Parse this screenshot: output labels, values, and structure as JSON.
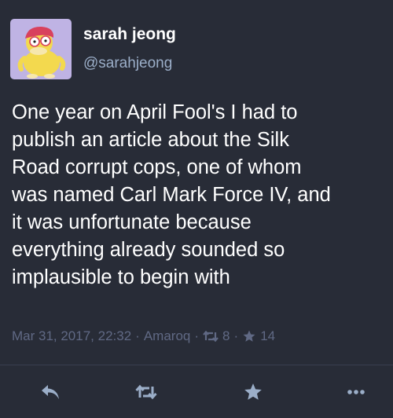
{
  "user": {
    "display_name": "sarah jeong",
    "handle": "@sarahjeong"
  },
  "status": {
    "lines": [
      "One year on April Fool's I had to",
      "publish an article about the Silk",
      "Road corrupt cops, one of whom",
      "was named Carl Mark Force IV, and",
      "it was unfortunate because",
      "everything already sounded so",
      "implausible to begin with"
    ],
    "timestamp": "Mar 31, 2017, 22:32",
    "separator": "·",
    "application": "Amaroq",
    "boost_count": "8",
    "favourite_count": "14"
  },
  "icons": {
    "avatar": "psyduck-avatar",
    "boost": "boost-icon",
    "star": "star-icon",
    "reply": "reply-icon",
    "more": "more-icon"
  },
  "colors": {
    "background": "#282c37",
    "text": "#ffffff",
    "secondary": "#9baec8",
    "muted": "#606984",
    "avatar_bg": "#bfb3e4",
    "divider": "#393f4f"
  }
}
